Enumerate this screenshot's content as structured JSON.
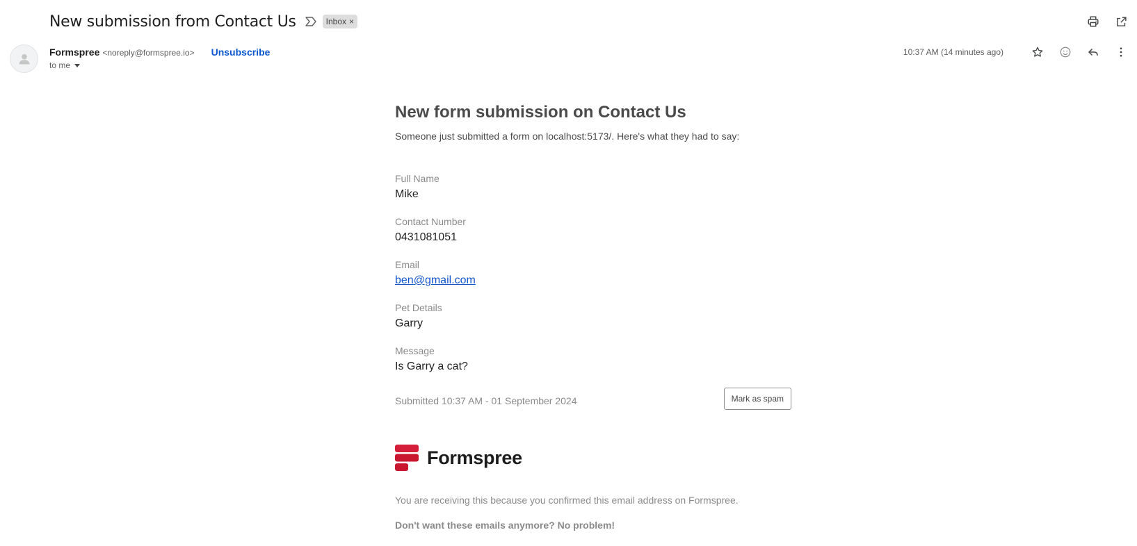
{
  "subject": {
    "title": "New submission from Contact Us",
    "label": "Inbox",
    "label_remove": "×"
  },
  "sender": {
    "name": "Formspree",
    "email": "<noreply@formspree.io>",
    "unsubscribe": "Unsubscribe",
    "to": "to me",
    "timestamp": "10:37 AM (14 minutes ago)"
  },
  "icons": {
    "importance": "importance-marker-icon",
    "print": "print-icon",
    "new_window": "open-in-new-window-icon",
    "star": "star-icon",
    "emoji": "emoji-reaction-icon",
    "reply": "reply-icon",
    "more": "more-vert-icon",
    "avatar": "person-icon",
    "dropdown": "caret-down-icon"
  },
  "body": {
    "heading": "New form submission on Contact Us",
    "intro": "Someone just submitted a form on localhost:5173/. Here's what they had to say:",
    "fields": [
      {
        "label": "Full Name",
        "value": "Mike"
      },
      {
        "label": "Contact Number",
        "value": "0431081051"
      },
      {
        "label": "Email",
        "value": "ben@gmail.com"
      },
      {
        "label": "Pet Details",
        "value": "Garry"
      },
      {
        "label": "Message",
        "value": "Is Garry a cat?"
      }
    ],
    "submitted": "Submitted 10:37 AM - 01 September 2024",
    "spam_button": "Mark as spam",
    "brand_name": "Formspree",
    "footer_note": "You are receiving this because you confirmed this email address on Formspree.",
    "footer_bold": "Don't want these emails anymore? No problem!"
  },
  "colors": {
    "brand_red": "#d51f3a",
    "link_blue": "#1155cc",
    "unsubscribe_blue": "#0b57d0"
  }
}
